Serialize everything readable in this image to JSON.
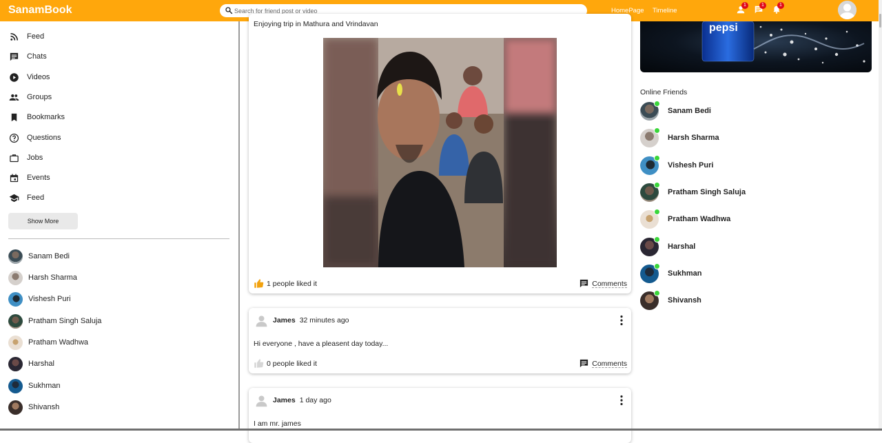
{
  "app": {
    "title": "SanamBook"
  },
  "search": {
    "placeholder": "Search for friend post or video"
  },
  "topnav": {
    "homepage": "HomePage",
    "timeline": "Timeline"
  },
  "notifications": [
    {
      "icon": "person-icon",
      "count": "1"
    },
    {
      "icon": "chat-icon",
      "count": "1"
    },
    {
      "icon": "bell-icon",
      "count": "1"
    }
  ],
  "sidebar": {
    "menu": [
      {
        "label": "Feed",
        "icon": "rss-feed-icon"
      },
      {
        "label": "Chats",
        "icon": "chat-icon"
      },
      {
        "label": "Videos",
        "icon": "play-circle-icon"
      },
      {
        "label": "Groups",
        "icon": "group-icon"
      },
      {
        "label": "Bookmarks",
        "icon": "bookmark-icon"
      },
      {
        "label": "Questions",
        "icon": "help-circle-icon"
      },
      {
        "label": "Jobs",
        "icon": "briefcase-icon"
      },
      {
        "label": "Events",
        "icon": "calendar-icon"
      },
      {
        "label": "Feed",
        "icon": "school-icon"
      }
    ],
    "show_more": "Show More",
    "friends": [
      "Sanam Bedi",
      "Harsh Sharma",
      "Vishesh Puri",
      "Pratham Singh Saluja",
      "Pratham Wadhwa",
      "Harshal",
      "Sukhman",
      "Shivansh"
    ]
  },
  "feed": {
    "posts": [
      {
        "text": "Enjoying trip in Mathura and Vrindavan",
        "likes": "1 people liked it",
        "comments": "Comments"
      },
      {
        "author": "James",
        "time": "32 minutes ago",
        "text": "Hi everyone , have a pleasent day today...",
        "likes": "0 people liked it",
        "comments": "Comments"
      },
      {
        "author": "James",
        "time": "1 day ago",
        "text": "I am mr. james"
      }
    ]
  },
  "rightbar": {
    "ad_text": "pepsi",
    "online_title": "Online Friends",
    "online_friends": [
      "Sanam Bedi",
      "Harsh Sharma",
      "Vishesh Puri",
      "Pratham Singh Saluja",
      "Pratham Wadhwa",
      "Harshal",
      "Sukhman",
      "Shivansh"
    ]
  },
  "colors": {
    "brand": "#ffa70c",
    "badge": "#e0091a",
    "online": "#3ad63a",
    "like": "#f2a20f"
  }
}
